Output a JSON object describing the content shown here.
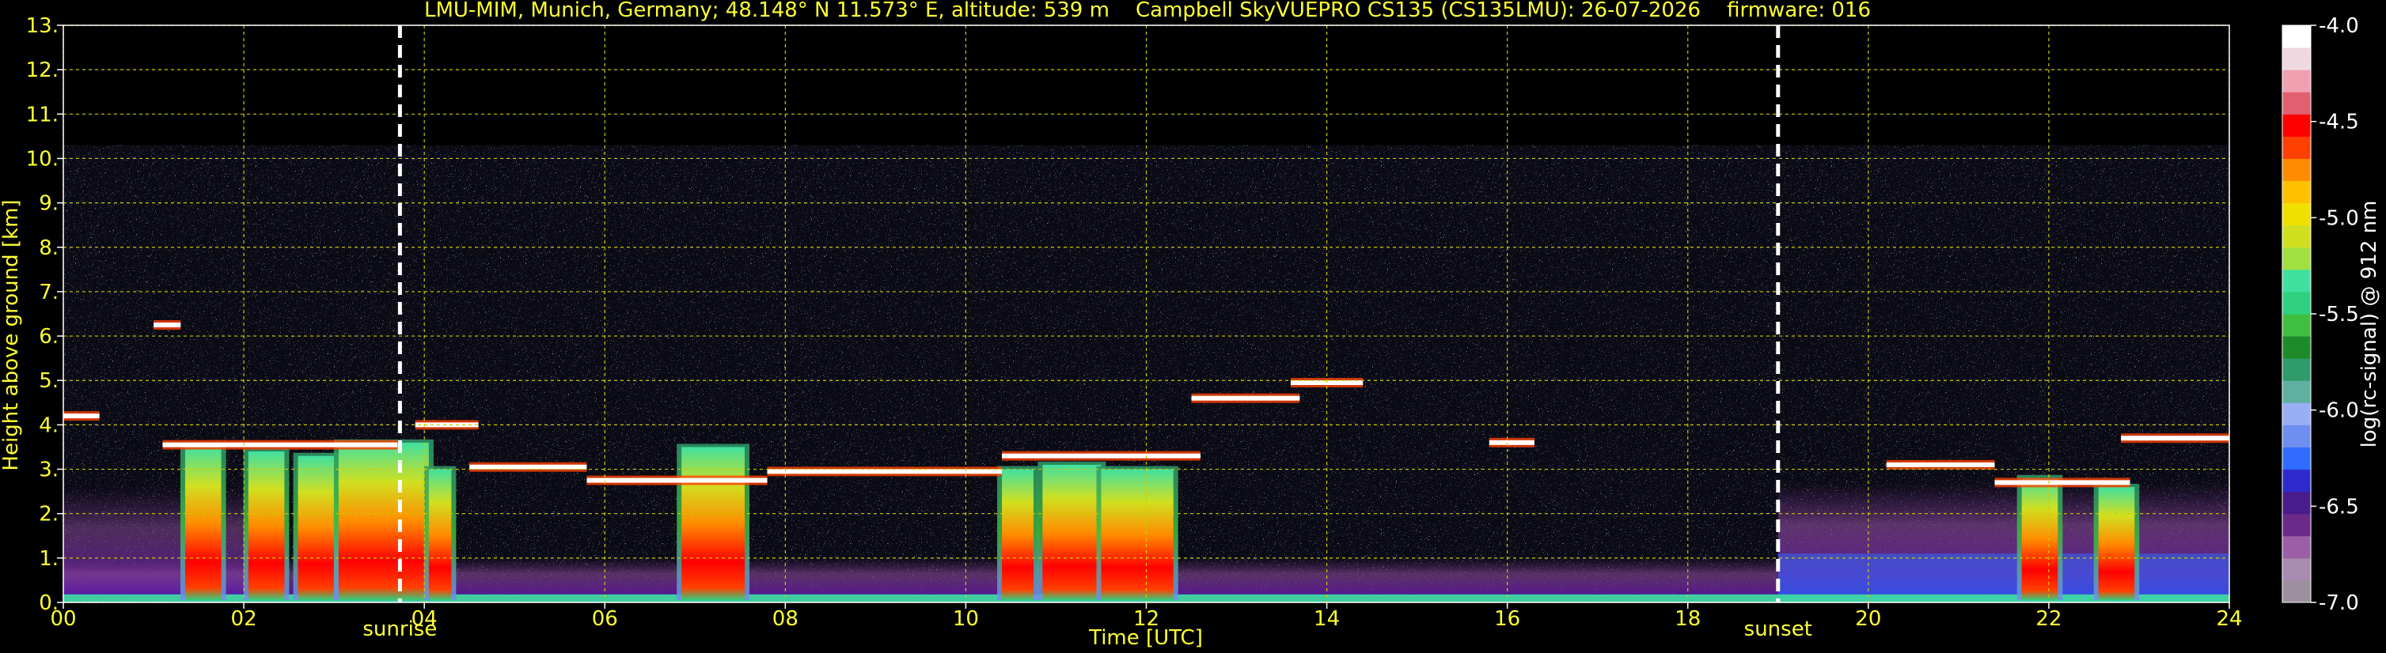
{
  "chart_data": {
    "type": "heatmap",
    "title": "LMU-MIM, Munich, Germany; 48.148° N 11.573° E, altitude: 539 m    Campbell SkyVUEPRO CS135 (CS135LMU): 26-07-2026    firmware: 016",
    "xlabel": "Time [UTC]",
    "ylabel": "Height above ground [km]",
    "xlim": [
      0,
      24
    ],
    "ylim": [
      0,
      13
    ],
    "x_ticks": [
      "00",
      "02",
      "04",
      "06",
      "08",
      "10",
      "12",
      "14",
      "16",
      "18",
      "20",
      "22",
      "24"
    ],
    "y_ticks": [
      "0.",
      "1.",
      "2.",
      "3.",
      "4.",
      "5.",
      "6.",
      "7.",
      "8.",
      "9.",
      "10.",
      "11.",
      "12.",
      "13."
    ],
    "grid": true,
    "annotations": [
      {
        "label": "sunrise",
        "x": 3.73
      },
      {
        "label": "sunset",
        "x": 19.0
      }
    ],
    "colorbar": {
      "label": "log(rc-signal) @ 912 nm",
      "range": [
        -7.0,
        -4.0
      ],
      "ticks": [
        "-4.0",
        "-4.5",
        "-5.0",
        "-5.5",
        "-6.0",
        "-6.5",
        "-7.0"
      ],
      "colors": [
        "#9e8fa0",
        "#a98ab0",
        "#9a5fa6",
        "#6a2a8a",
        "#4a1b8a",
        "#2e2bcc",
        "#2f6cff",
        "#6f8ff0",
        "#9aaef5",
        "#5fb0a0",
        "#2f9a6a",
        "#1f8a2a",
        "#3fbf3f",
        "#2fd080",
        "#40e0a0",
        "#a0e040",
        "#d0e020",
        "#f0e000",
        "#ffc000",
        "#ff8c00",
        "#ff4000",
        "#ff0000",
        "#e06070",
        "#f0a0b0",
        "#f0d8e0",
        "#ffffff"
      ]
    },
    "features": {
      "cloud_base_segments": [
        {
          "x": [
            0.0,
            0.4
          ],
          "y": 4.2
        },
        {
          "x": [
            1.0,
            1.3
          ],
          "y": 6.25
        },
        {
          "x": [
            1.1,
            3.7
          ],
          "y": 3.55
        },
        {
          "x": [
            3.9,
            4.6
          ],
          "y": 4.0
        },
        {
          "x": [
            4.5,
            5.8
          ],
          "y": 3.05
        },
        {
          "x": [
            5.8,
            7.8
          ],
          "y": 2.75
        },
        {
          "x": [
            7.8,
            10.4
          ],
          "y": 2.95
        },
        {
          "x": [
            10.4,
            12.6
          ],
          "y": 3.3
        },
        {
          "x": [
            12.5,
            13.7
          ],
          "y": 4.6
        },
        {
          "x": [
            13.6,
            14.4
          ],
          "y": 4.95
        },
        {
          "x": [
            15.8,
            16.3
          ],
          "y": 3.6
        },
        {
          "x": [
            20.2,
            21.4
          ],
          "y": 3.1
        },
        {
          "x": [
            21.4,
            22.9
          ],
          "y": 2.7
        },
        {
          "x": [
            22.8,
            24.0
          ],
          "y": 3.7
        }
      ],
      "precipitation_bands": [
        {
          "x": [
            1.35,
            1.75
          ],
          "top": 3.5
        },
        {
          "x": [
            2.05,
            2.45
          ],
          "top": 3.4
        },
        {
          "x": [
            2.6,
            3.0
          ],
          "top": 3.3
        },
        {
          "x": [
            3.05,
            4.05
          ],
          "top": 3.6
        },
        {
          "x": [
            4.05,
            4.3
          ],
          "top": 3.0
        },
        {
          "x": [
            6.85,
            7.55
          ],
          "top": 3.5
        },
        {
          "x": [
            10.4,
            10.75
          ],
          "top": 3.0
        },
        {
          "x": [
            10.85,
            11.5
          ],
          "top": 3.1
        },
        {
          "x": [
            11.5,
            12.3
          ],
          "top": 3.0
        },
        {
          "x": [
            21.7,
            22.1
          ],
          "top": 2.8
        },
        {
          "x": [
            22.55,
            22.95
          ],
          "top": 2.6
        }
      ],
      "noise_top_km": 10.3
    }
  }
}
